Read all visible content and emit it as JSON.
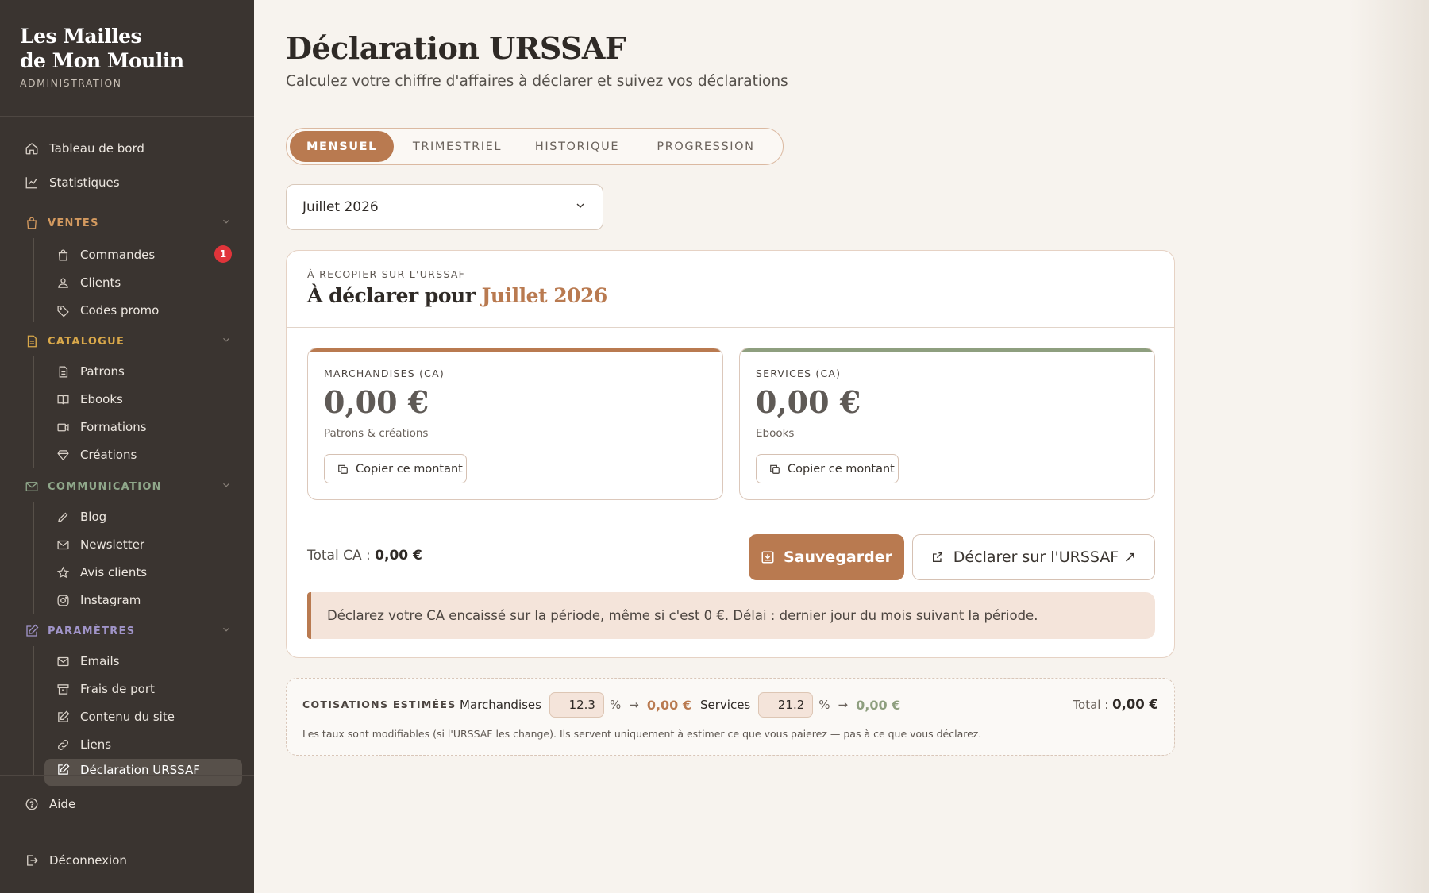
{
  "brand": {
    "line1": "Les Mailles",
    "line2": "de Mon Moulin",
    "sub": "ADMINISTRATION"
  },
  "colors": {
    "accent": "#b97a50",
    "sidebar_bg": "#3a3430",
    "services": "#8e9f7f",
    "ventes": "#d49a5f",
    "catalogue": "#d9a84a",
    "communication": "#8fa78a",
    "parametres": "#a094c8",
    "badge": "#e0343a"
  },
  "sidebar": {
    "top": [
      {
        "label": "Tableau de bord",
        "icon": "home-icon"
      },
      {
        "label": "Statistiques",
        "icon": "chart-line-icon"
      }
    ],
    "ventes": {
      "label": "VENTES",
      "icon": "bag-icon",
      "items": [
        {
          "label": "Commandes",
          "icon": "bag-icon",
          "badge": "1"
        },
        {
          "label": "Clients",
          "icon": "users-icon"
        },
        {
          "label": "Codes promo",
          "icon": "tag-icon"
        }
      ]
    },
    "catalogue": {
      "label": "CATALOGUE",
      "icon": "document-icon",
      "items": [
        {
          "label": "Patrons",
          "icon": "document-icon"
        },
        {
          "label": "Ebooks",
          "icon": "book-icon"
        },
        {
          "label": "Formations",
          "icon": "video-icon"
        },
        {
          "label": "Créations",
          "icon": "diamond-icon"
        }
      ]
    },
    "communication": {
      "label": "COMMUNICATION",
      "icon": "mail-icon",
      "items": [
        {
          "label": "Blog",
          "icon": "pencil-icon"
        },
        {
          "label": "Newsletter",
          "icon": "mail-icon"
        },
        {
          "label": "Avis clients",
          "icon": "star-icon"
        },
        {
          "label": "Instagram",
          "icon": "instagram-icon"
        }
      ]
    },
    "parametres": {
      "label": "PARAMÈTRES",
      "icon": "edit-icon",
      "items": [
        {
          "label": "Emails",
          "icon": "mail-icon"
        },
        {
          "label": "Frais de port",
          "icon": "box-icon"
        },
        {
          "label": "Contenu du site",
          "icon": "edit-icon"
        },
        {
          "label": "Liens",
          "icon": "link-icon"
        },
        {
          "label": "Déclaration URSSAF",
          "icon": "edit-icon",
          "active": true
        }
      ]
    },
    "help": "Aide",
    "logout": "Déconnexion"
  },
  "header": {
    "title": "Déclaration URSSAF",
    "subtitle": "Calculez votre chiffre d'affaires à déclarer et suivez vos déclarations"
  },
  "tabs": [
    {
      "label": "MENSUEL",
      "active": true
    },
    {
      "label": "TRIMESTRIEL"
    },
    {
      "label": "HISTORIQUE"
    },
    {
      "label": "PROGRESSION"
    }
  ],
  "period_select": {
    "value": "Juillet 2026"
  },
  "declaration": {
    "kicker": "À RECOPIER SUR L'URSSAF",
    "title_prefix": "À déclarer pour ",
    "title_period": "Juillet 2026",
    "marchandises": {
      "label": "MARCHANDISES (CA)",
      "amount": "0,00 €",
      "desc": "Patrons & créations",
      "copy_label": "Copier ce montant"
    },
    "services": {
      "label": "SERVICES (CA)",
      "amount": "0,00 €",
      "desc": "Ebooks",
      "copy_label": "Copier ce montant"
    },
    "total_label": "Total CA : ",
    "total_value": "0,00 €",
    "save_label": "Sauvegarder",
    "urssaf_label": "Déclarer sur l'URSSAF ↗",
    "notice": "Déclarez votre CA encaissé sur la période, même si c'est 0 €. Délai : dernier jour du mois suivant la période."
  },
  "cotisations": {
    "label": "COTISATIONS ESTIMÉES",
    "marchandises_label": "Marchandises",
    "marchandises_rate": "12.3",
    "marchandises_amount": "0,00 €",
    "services_label": "Services",
    "services_rate": "21.2",
    "services_amount": "0,00 €",
    "pct": "%",
    "arrow": "→",
    "total_label": "Total : ",
    "total_value": "0,00 €",
    "note": "Les taux sont modifiables (si l'URSSAF les change). Ils servent uniquement à estimer ce que vous paierez — pas à ce que vous déclarez."
  }
}
